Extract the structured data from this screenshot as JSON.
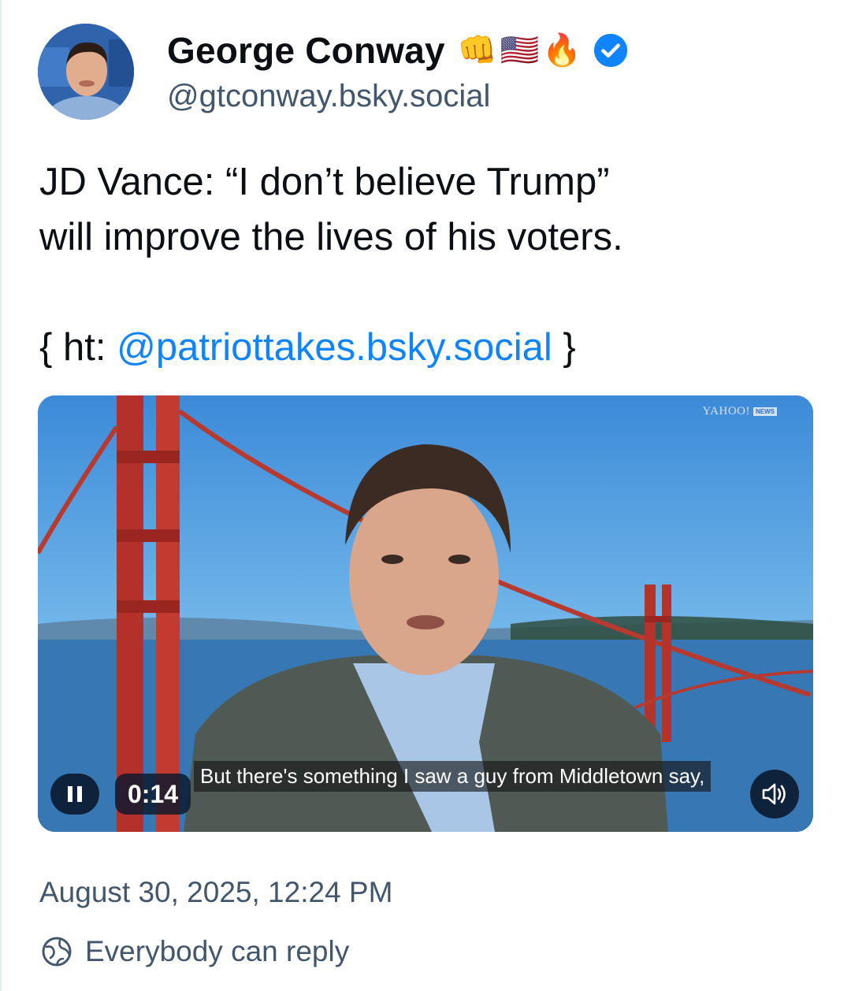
{
  "author": {
    "display_name": "George Conway",
    "handle": "@gtconway.bsky.social",
    "emojis": [
      "👊",
      "🇺🇸",
      "🔥"
    ],
    "verified": true,
    "avatar_icon": "avatar-photo"
  },
  "post": {
    "line1": "JD Vance: “I don’t believe Trump”",
    "line2": "will improve the lives of his voters.",
    "ht_prefix": "{ ht: ",
    "ht_mention": "@patriottakes.bsky.social",
    "ht_suffix": " }"
  },
  "video": {
    "watermark_brand": "YAHOO!",
    "watermark_sub": "NEWS",
    "caption": "But there's something I saw a guy from Middletown say,",
    "time": "0:14",
    "pause_icon": "pause-icon",
    "sound_icon": "speaker-icon",
    "progress": 0.0
  },
  "meta": {
    "timestamp": "August 30, 2025, 12:24 PM",
    "reply_setting": "Everybody can reply",
    "reply_icon": "globe-icon"
  },
  "colors": {
    "link": "#1083fe",
    "secondary_text": "#42566c",
    "verified": "#1083fe"
  }
}
